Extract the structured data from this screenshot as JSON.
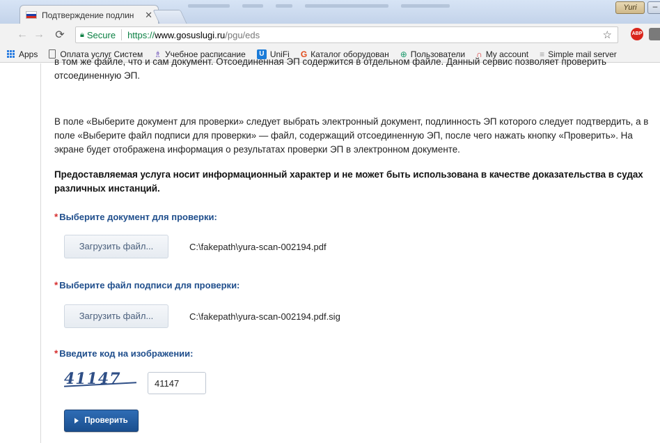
{
  "browser": {
    "tab_title": "Подтверждение подлин",
    "tab_close": "✕",
    "user_badge": "Yuri",
    "address": {
      "secure_label": "Secure",
      "scheme": "https://",
      "host": "www.gosuslugi.ru",
      "path": "/pgu/eds"
    },
    "abp_label": "ABP",
    "bookmarks": [
      {
        "label": "Apps",
        "icon": "apps-grid-icon"
      },
      {
        "label": "Оплата услуг Систем",
        "icon": "document-icon"
      },
      {
        "label": "Учебное расписание",
        "icon": "schedule-icon"
      },
      {
        "label": "UniFi",
        "icon": "unifi-icon"
      },
      {
        "label": "Каталог оборудован",
        "icon": "catalog-icon"
      },
      {
        "label": "Пользователи",
        "icon": "users-icon"
      },
      {
        "label": "My account",
        "icon": "account-icon"
      },
      {
        "label": "Simple mail server",
        "icon": "mail-server-icon"
      }
    ],
    "colors": {
      "secure_green": "#0b8043",
      "chrome_bg": "#f2f2f2"
    }
  },
  "page": {
    "intro_clipped_line1": "в том же файле, что и сам документ. Отсоединенная ЭП содержится в отдельном файле. Данный сервис позволяет проверить",
    "intro_clipped_line2": "отсоединенную ЭП.",
    "instructions": "В поле «Выберите документ для проверки» следует выбрать электронный документ, подлинность ЭП которого следует подтвердить, а в поле «Выберите файл подписи для проверки» — файл, содержащий отсоединенную ЭП, после чего нажать кнопку «Проверить». На экране будет отображена информация о результатах проверки ЭП в электронном документе.",
    "disclaimer": "Предоставляемая услуга носит информационный характер и не может быть использована в качестве доказательства в судах различных инстанций.",
    "required_mark": "*",
    "document_field": {
      "label": "Выберите документ для проверки:",
      "button": "Загрузить файл...",
      "filename": "C:\\fakepath\\yura-scan-002194.pdf"
    },
    "signature_field": {
      "label": "Выберите файл подписи для проверки:",
      "button": "Загрузить файл...",
      "filename": "C:\\fakepath\\yura-scan-002194.pdf.sig"
    },
    "captcha": {
      "label": "Введите код на изображении:",
      "image_text": "41147",
      "input_value": "41147"
    },
    "submit_button": "Проверить",
    "colors": {
      "label_blue": "#1f4e8c",
      "required_red": "#d63030",
      "button_blue": "#1a4f8f"
    }
  }
}
